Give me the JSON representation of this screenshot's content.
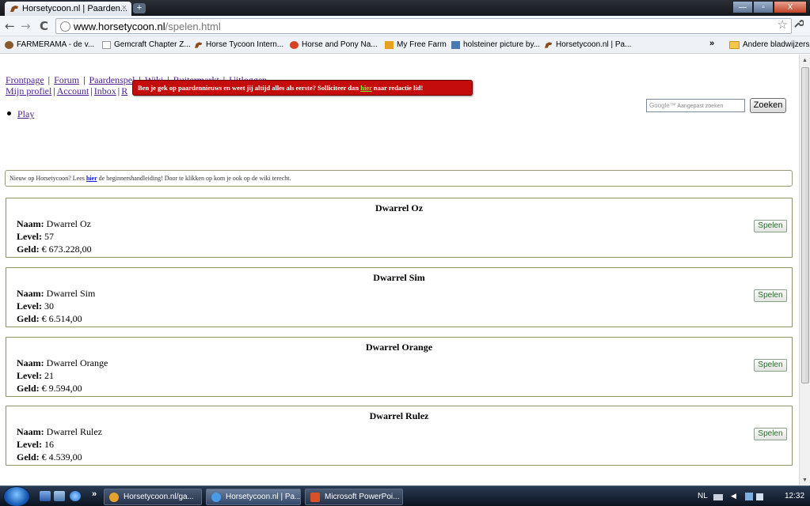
{
  "browser": {
    "tab_title": "Horsetycoon.nl | Paarden...",
    "tab_close": "×",
    "new_tab": "+",
    "window_controls": {
      "minimize": "—",
      "maximize": "▫",
      "close": "X"
    },
    "url_host": "www.horsetycoon.nl",
    "url_path": "/spelen.html",
    "back": "←",
    "forward": "→",
    "reload": "C",
    "star": "☆",
    "wrench": "🔧"
  },
  "bookmarks": [
    {
      "label": "FARMERAMA - de v...",
      "icon_color": "#8a5a2a"
    },
    {
      "label": "Gemcraft Chapter Z...",
      "icon_color": "#dddddd"
    },
    {
      "label": "Horse Tycoon Intern...",
      "icon_color": "#8a4a1a"
    },
    {
      "label": "Horse and Pony Na...",
      "icon_color": "#d84020"
    },
    {
      "label": "My Free Farm",
      "icon_color": "#e8a020"
    },
    {
      "label": "holsteiner picture by...",
      "icon_color": "#4a7ab0"
    },
    {
      "label": "Horsetycoon.nl | Pa...",
      "icon_color": "#8a4a1a"
    }
  ],
  "bookmarks_more": "»",
  "bookmarks_other": "Andere bladwijzers",
  "nav": {
    "row1": [
      "Frontpage",
      "Forum",
      "Paardenspel",
      "Wiki",
      "Ruitermarkt",
      "Uitloggen"
    ],
    "row2": [
      "Mijn profiel",
      "Account",
      "Inbox",
      "R"
    ],
    "sep": "|"
  },
  "alert": {
    "text_before": "Ben je gek op paardennieuws en weet jij altijd alles als eerste? Solliciteer dan ",
    "link": "hier",
    "text_after": " naar redactie lid!"
  },
  "menu": {
    "play": "Play"
  },
  "search": {
    "placeholder_logo": "Google™",
    "placeholder": "Aangepast zoeken",
    "button": "Zoeken"
  },
  "info": {
    "text_before": "Nieuw op Horsetycoon? Lees ",
    "link": "hier",
    "text_after": " de beginnershandleiding! Door te klikken op kom je ook op de wiki terecht."
  },
  "labels": {
    "naam": "Naam:",
    "level": "Level:",
    "geld": "Geld:",
    "spelen": "Spelen"
  },
  "stables": [
    {
      "title": "Dwarrel Oz",
      "naam": "Dwarrel Oz",
      "level": "57",
      "geld": "€ 673.228,00"
    },
    {
      "title": "Dwarrel Sim",
      "naam": "Dwarrel Sim",
      "level": "30",
      "geld": "€ 6.514,00"
    },
    {
      "title": "Dwarrel Orange",
      "naam": "Dwarrel Orange",
      "level": "21",
      "geld": "€ 9.594,00"
    },
    {
      "title": "Dwarrel Rulez",
      "naam": "Dwarrel Rulez",
      "level": "16",
      "geld": "€ 4.539,00"
    }
  ],
  "taskbar": {
    "chevron": "»",
    "buttons": [
      {
        "label": "Horsetycoon.nl/ga...",
        "icon_color": "#e8a030",
        "active": false
      },
      {
        "label": "Horsetycoon.nl | Pa...",
        "icon_color": "#4a9ae8",
        "active": true
      },
      {
        "label": "Microsoft PowerPoi...",
        "icon_color": "#d8502a",
        "active": false
      }
    ],
    "lang": "NL",
    "clock": "12:32"
  }
}
